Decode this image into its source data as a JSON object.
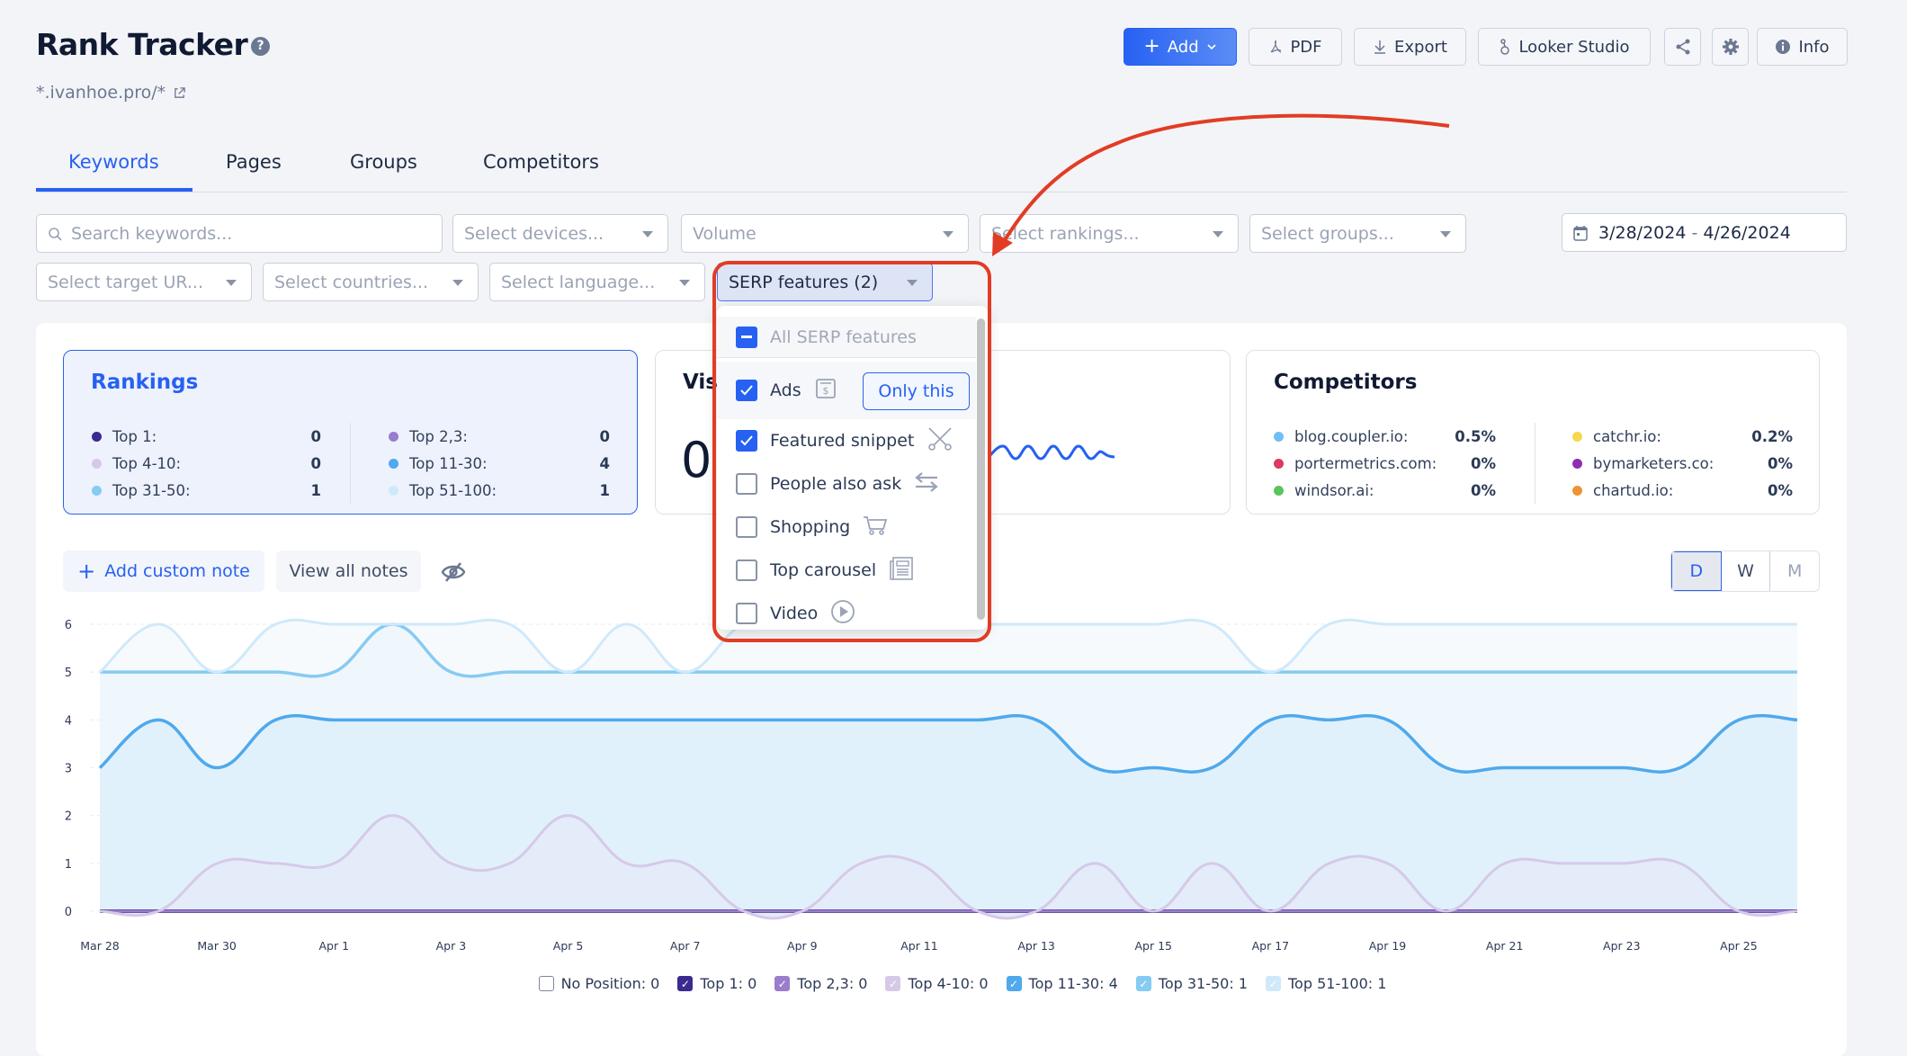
{
  "header": {
    "title": "Rank Tracker",
    "help_icon": "question-circle-icon",
    "domain": "*.ivanhoe.pro/*",
    "domain_icon": "external-link-icon"
  },
  "toolbar": {
    "add": "Add",
    "pdf": "PDF",
    "export": "Export",
    "looker": "Looker Studio",
    "share_icon": "share-icon",
    "settings_icon": "gear-icon",
    "info": "Info",
    "accent": "#2761f2"
  },
  "tabs": [
    {
      "label": "Keywords",
      "active": true
    },
    {
      "label": "Pages",
      "active": false
    },
    {
      "label": "Groups",
      "active": false
    },
    {
      "label": "Competitors",
      "active": false
    }
  ],
  "filters": {
    "search_placeholder": "Search keywords...",
    "devices": "Select devices...",
    "volume": "Volume",
    "rankings": "Select rankings...",
    "groups": "Select groups...",
    "date_start": "3/28/2024",
    "date_sep": " - ",
    "date_end": "4/26/2024",
    "target_url": "Select target UR...",
    "countries": "Select countries...",
    "language": "Select language...",
    "serp": "SERP features (2)"
  },
  "serp_dropdown": {
    "all_label": "All SERP features",
    "all_state": "indeterminate",
    "only_this": "Only this",
    "items": [
      {
        "label": "Ads",
        "checked": true,
        "icon": "dollar-receipt-icon"
      },
      {
        "label": "Featured snippet",
        "checked": true,
        "icon": "scissors-icon"
      },
      {
        "label": "People also ask",
        "checked": false,
        "icon": "swap-arrows-icon"
      },
      {
        "label": "Shopping",
        "checked": false,
        "icon": "cart-icon"
      },
      {
        "label": "Top carousel",
        "checked": false,
        "icon": "newspaper-icon"
      },
      {
        "label": "Video",
        "checked": false,
        "icon": "play-circle-icon"
      }
    ]
  },
  "rankings_card": {
    "title": "Rankings",
    "left": [
      {
        "label": "Top 1:",
        "value": "0",
        "color": "#3b2a8f"
      },
      {
        "label": "Top 4-10:",
        "value": "0",
        "color": "#d6c9e8"
      },
      {
        "label": "Top 31-50:",
        "value": "1",
        "color": "#86cbf3"
      }
    ],
    "right": [
      {
        "label": "Top 2,3:",
        "value": "0",
        "color": "#9a7dcc"
      },
      {
        "label": "Top 11-30:",
        "value": "4",
        "color": "#4fa9ec"
      },
      {
        "label": "Top 51-100:",
        "value": "1",
        "color": "#cfe9fb"
      }
    ]
  },
  "visibility_card": {
    "title_visible": "Visi",
    "value_visible": "0."
  },
  "competitors_card": {
    "title": "Competitors",
    "left": [
      {
        "label": "blog.coupler.io:",
        "value": "0.5%",
        "color": "#6fbff6"
      },
      {
        "label": "portermetrics.com:",
        "value": "0%",
        "color": "#dc3a60"
      },
      {
        "label": "windsor.ai:",
        "value": "0%",
        "color": "#5bc45a"
      }
    ],
    "right": [
      {
        "label": "catchr.io:",
        "value": "0.2%",
        "color": "#f7d84a"
      },
      {
        "label": "bymarketers.co:",
        "value": "0%",
        "color": "#8e2fb0"
      },
      {
        "label": "chartud.io:",
        "value": "0%",
        "color": "#ee9436"
      }
    ]
  },
  "notes": {
    "add": "Add custom note",
    "view": "View all notes",
    "hide_icon": "eye-off-icon"
  },
  "granularity": {
    "options": [
      "D",
      "W",
      "M"
    ],
    "selected": "D"
  },
  "chart_data": {
    "type": "area",
    "stacked": true,
    "title": "",
    "xlabel": "",
    "ylabel": "",
    "ylim": [
      0,
      6
    ],
    "yticks": [
      0,
      1,
      2,
      3,
      4,
      5,
      6
    ],
    "grid": true,
    "legend_position": "bottom",
    "x": [
      "Mar 28",
      "Mar 29",
      "Mar 30",
      "Mar 31",
      "Apr 1",
      "Apr 2",
      "Apr 3",
      "Apr 4",
      "Apr 5",
      "Apr 6",
      "Apr 7",
      "Apr 8",
      "Apr 9",
      "Apr 10",
      "Apr 11",
      "Apr 12",
      "Apr 13",
      "Apr 14",
      "Apr 15",
      "Apr 16",
      "Apr 17",
      "Apr 18",
      "Apr 19",
      "Apr 20",
      "Apr 21",
      "Apr 22",
      "Apr 23",
      "Apr 24",
      "Apr 25",
      "Apr 26"
    ],
    "xtick_labels": [
      "Mar 28",
      "Mar 30",
      "Apr 1",
      "Apr 3",
      "Apr 5",
      "Apr 7",
      "Apr 9",
      "Apr 11",
      "Apr 13",
      "Apr 15",
      "Apr 17",
      "Apr 19",
      "Apr 21",
      "Apr 23",
      "Apr 25"
    ],
    "series": [
      {
        "name": "Top 1",
        "color": "#3b2a8f",
        "values": [
          0,
          0,
          0,
          0,
          0,
          0,
          0,
          0,
          0,
          0,
          0,
          0,
          0,
          0,
          0,
          0,
          0,
          0,
          0,
          0,
          0,
          0,
          0,
          0,
          0,
          0,
          0,
          0,
          0,
          0
        ]
      },
      {
        "name": "Top 2,3",
        "color": "#9a7dcc",
        "values": [
          0,
          0,
          0,
          0,
          0,
          0,
          0,
          0,
          0,
          0,
          0,
          0,
          0,
          0,
          0,
          0,
          0,
          0,
          0,
          0,
          0,
          0,
          0,
          0,
          0,
          0,
          0,
          0,
          0,
          0
        ]
      },
      {
        "name": "Top 4-10",
        "color": "#d6c9e8",
        "values": [
          0,
          0,
          1,
          1,
          1,
          2,
          1,
          1,
          2,
          1,
          1,
          0,
          0,
          1,
          1,
          0,
          0,
          1,
          0,
          1,
          0,
          1,
          1,
          0,
          1,
          1,
          1,
          1,
          0,
          0
        ]
      },
      {
        "name": "Top 11-30",
        "color": "#4fa9ec",
        "values": [
          3,
          4,
          2,
          3,
          3,
          2,
          3,
          3,
          2,
          3,
          3,
          4,
          4,
          3,
          3,
          4,
          4,
          2,
          3,
          2,
          4,
          3,
          3,
          3,
          2,
          2,
          2,
          2,
          4,
          4
        ]
      },
      {
        "name": "Top 31-50",
        "color": "#86cbf3",
        "values": [
          2,
          1,
          2,
          1,
          1,
          2,
          1,
          1,
          1,
          1,
          1,
          1,
          1,
          1,
          1,
          1,
          1,
          2,
          2,
          2,
          1,
          1,
          1,
          2,
          2,
          2,
          2,
          2,
          1,
          1
        ]
      },
      {
        "name": "Top 51-100",
        "color": "#cfe9fb",
        "values": [
          0,
          1,
          0,
          1,
          1,
          0,
          1,
          1,
          0,
          1,
          0,
          1,
          1,
          1,
          1,
          1,
          1,
          1,
          1,
          1,
          0,
          1,
          1,
          1,
          1,
          1,
          1,
          1,
          1,
          1
        ]
      }
    ],
    "legend": [
      {
        "label": "No Position: 0",
        "checked": false,
        "color": "#ffffff"
      },
      {
        "label": "Top 1: 0",
        "checked": true,
        "color": "#3b2a8f"
      },
      {
        "label": "Top 2,3: 0",
        "checked": true,
        "color": "#9a7dcc"
      },
      {
        "label": "Top 4-10: 0",
        "checked": true,
        "color": "#d6c9e8"
      },
      {
        "label": "Top 11-30: 4",
        "checked": true,
        "color": "#4fa9ec"
      },
      {
        "label": "Top 31-50: 1",
        "checked": true,
        "color": "#86cbf3"
      },
      {
        "label": "Top 51-100: 1",
        "checked": true,
        "color": "#cfe9fb"
      }
    ]
  },
  "annotation": {
    "color": "#e23c25",
    "type": "arrow-and-highlight"
  }
}
